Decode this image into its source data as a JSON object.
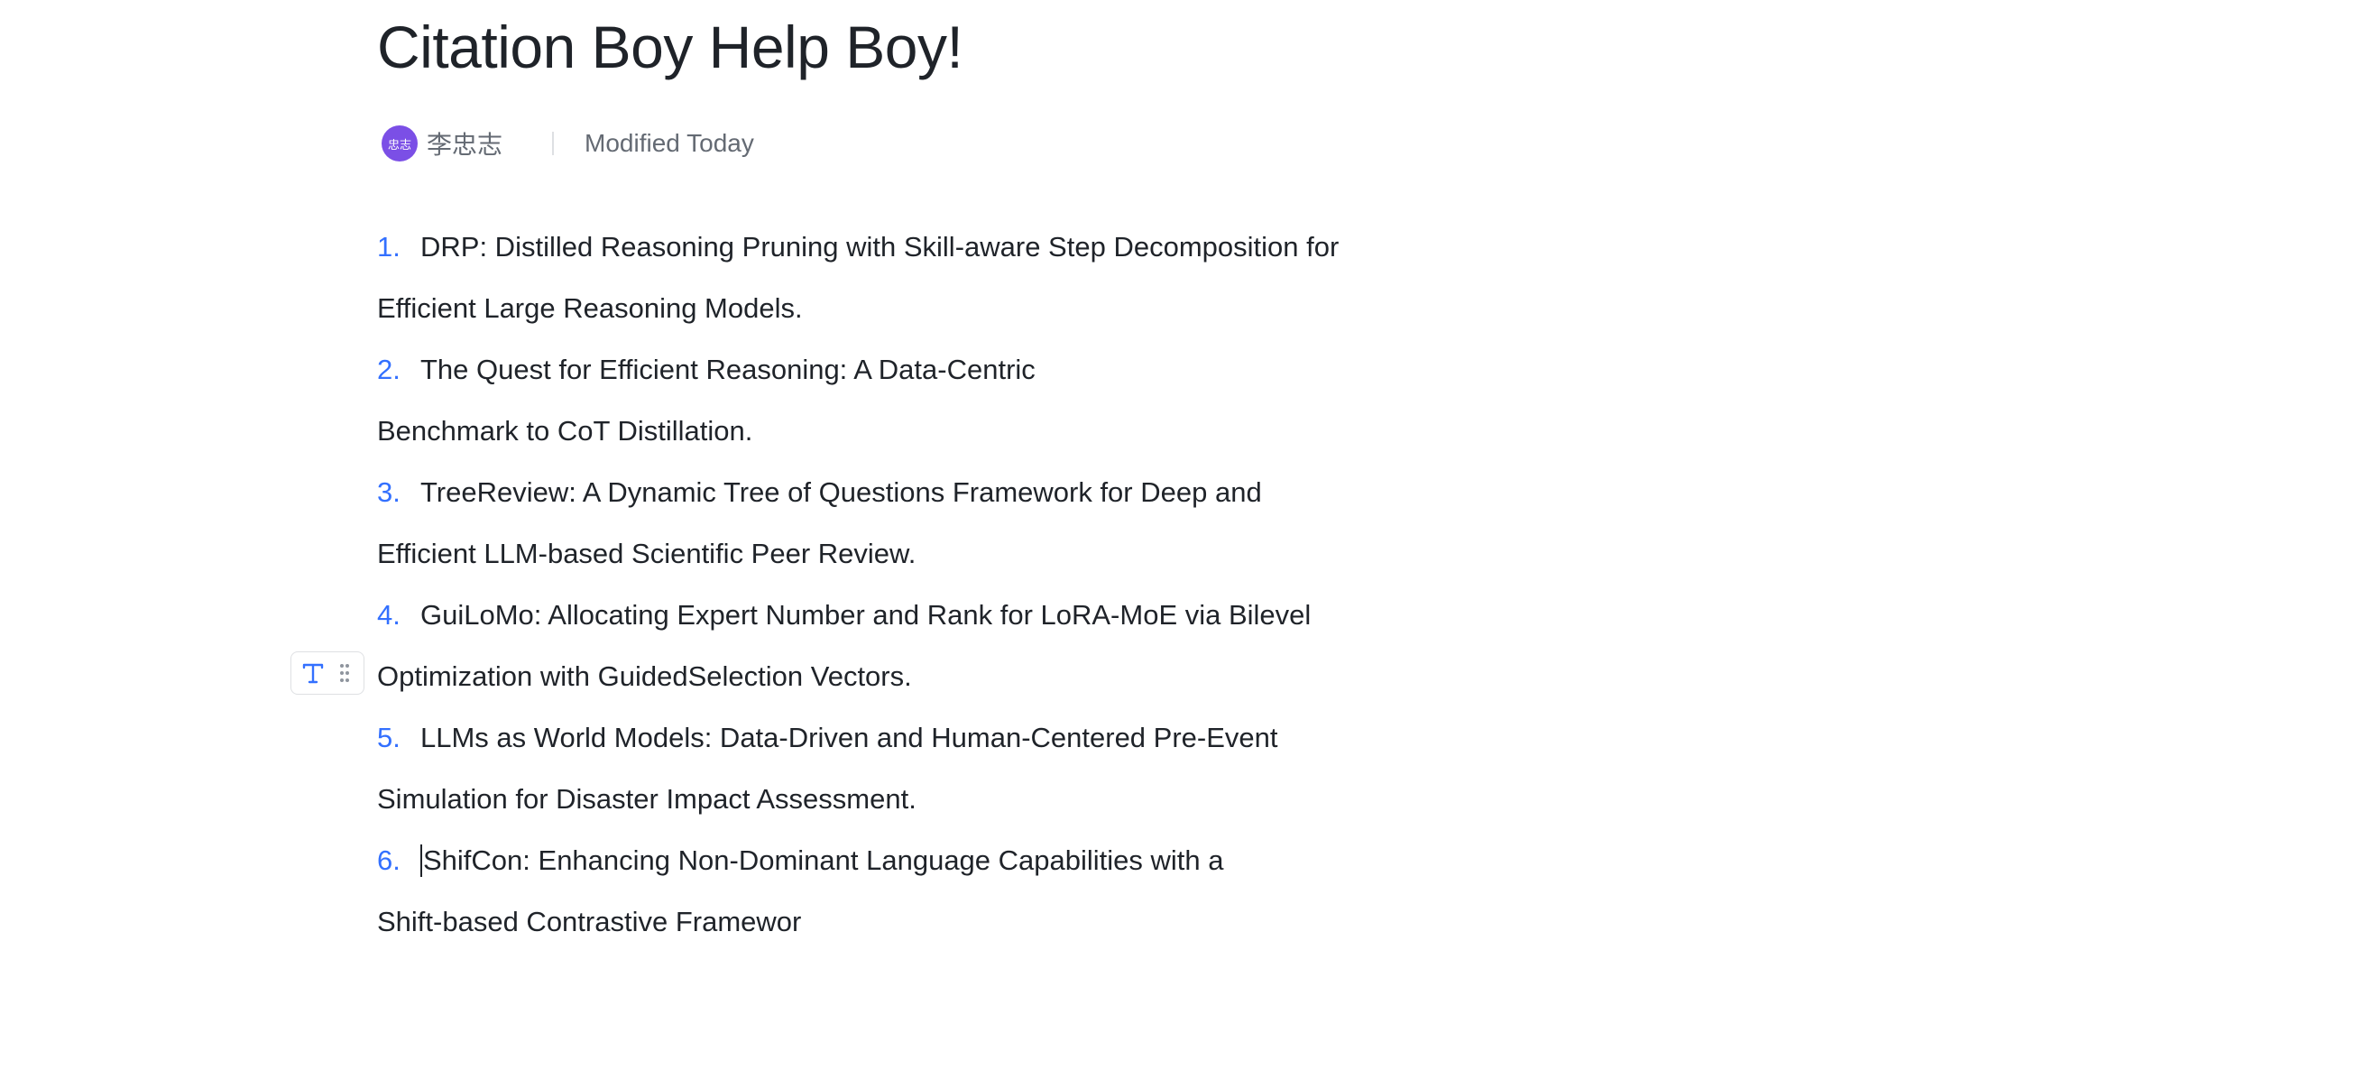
{
  "document": {
    "title": "Citation Boy Help Boy!",
    "author": {
      "avatar_text": "忠志",
      "name": "李忠志",
      "avatar_color": "#7b4fe6"
    },
    "modified": "Modified Today"
  },
  "list": [
    {
      "number": "1.",
      "line1": "DRP: Distilled Reasoning Pruning with Skill-aware Step Decomposition for",
      "line2": "Efficient Large Reasoning Models."
    },
    {
      "number": "2.",
      "line1": "The Quest for Efficient Reasoning: A Data-Centric",
      "line2": "Benchmark to CoT Distillation."
    },
    {
      "number": "3.",
      "line1": "TreeReview: A Dynamic Tree of Questions Framework for Deep and",
      "line2": "Efficient LLM-based Scientific Peer Review."
    },
    {
      "number": "4.",
      "line1": "GuiLoMo: Allocating Expert Number and Rank for LoRA-MoE via Bilevel",
      "line2": "Optimization with GuidedSelection Vectors."
    },
    {
      "number": "5.",
      "line1": "LLMs as World Models: Data-Driven and Human-Centered Pre-Event",
      "line2": "Simulation for Disaster Impact Assessment."
    },
    {
      "number": "6.",
      "line1": "ShifCon: Enhancing Non-Dominant Language Capabilities with a",
      "line2": "Shift-based Contrastive Framewor"
    }
  ],
  "block_handle": {
    "type_icon": "text-type-icon",
    "drag_icon": "drag-handle-icon"
  },
  "colors": {
    "accent": "#3370ff",
    "text": "#1f2329",
    "secondary_text": "#646a73"
  }
}
